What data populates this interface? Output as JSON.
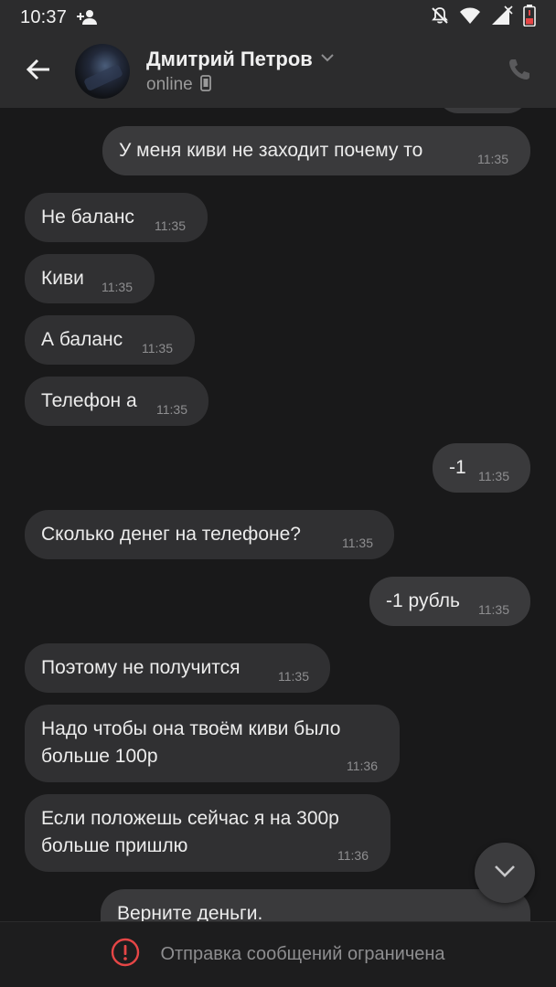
{
  "status_bar": {
    "time": "10:37",
    "icons": [
      "add-user-icon",
      "mute-icon",
      "wifi-icon",
      "signal-icon",
      "battery-low-icon"
    ]
  },
  "header": {
    "contact_name": "Дмитрий Петров",
    "contact_status": "online",
    "status_device_icon": "mobile-icon",
    "back_icon": "arrow-left-icon",
    "call_icon": "phone-icon"
  },
  "messages": [
    {
      "dir": "out",
      "text": "У меня киви не заходит почему то",
      "time": "11:35"
    },
    {
      "dir": "in",
      "text": "Не баланс",
      "time": "11:35"
    },
    {
      "dir": "in",
      "text": "Киви",
      "time": "11:35"
    },
    {
      "dir": "in",
      "text": "А баланс",
      "time": "11:35"
    },
    {
      "dir": "in",
      "text": "Телефон а",
      "time": "11:35"
    },
    {
      "dir": "out",
      "text": "-1",
      "time": "11:35"
    },
    {
      "dir": "in",
      "text": "Сколько денег на телефоне?",
      "time": "11:35"
    },
    {
      "dir": "out",
      "text": "-1 рубль",
      "time": "11:35"
    },
    {
      "dir": "in",
      "text": "Поэтому не получится",
      "time": "11:35"
    },
    {
      "dir": "in",
      "text": "Надо чтобы она твоём киви было\nбольше 100р",
      "time": "11:36"
    },
    {
      "dir": "in",
      "text": "Если положешь сейчас я на 300р\nбольше пришлю",
      "time": "11:36"
    },
    {
      "dir": "out",
      "text": "Верните деньги.",
      "time": ""
    }
  ],
  "bottom_bar": {
    "text": "Отправка сообщений ограничена",
    "icon": "alert-circle-icon"
  },
  "colors": {
    "background": "#19191a",
    "bar": "#2c2c2d",
    "bubble_in": "#303032",
    "bubble_out": "#3a3a3c",
    "alert_red": "#e64646"
  }
}
